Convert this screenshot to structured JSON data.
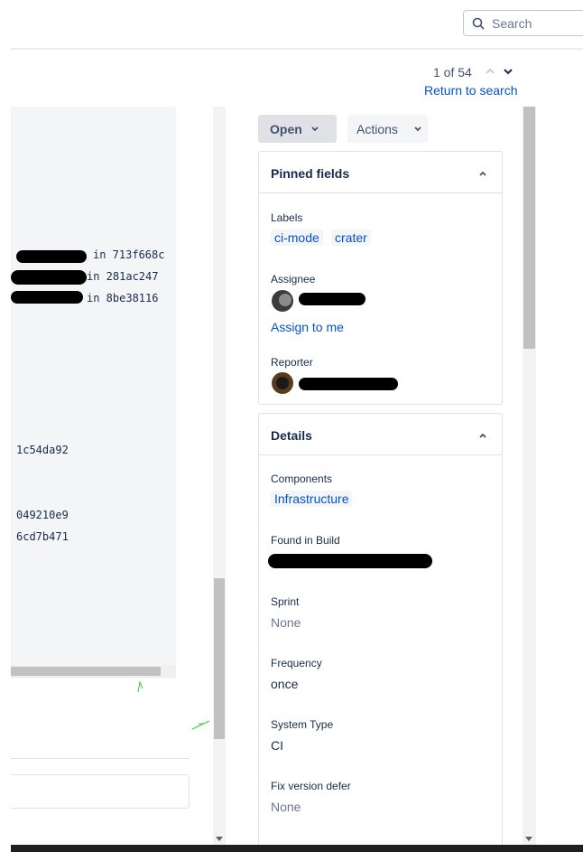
{
  "search": {
    "placeholder": "Search"
  },
  "pager": {
    "text": "1 of 54",
    "return_label": "Return to search"
  },
  "code": {
    "lines": [
      {
        "text": "in 713f668c"
      },
      {
        "text": "in 281ac247"
      },
      {
        "text": "in 8be38116"
      },
      {
        "text": "1c54da92"
      },
      {
        "text": "049210e9"
      },
      {
        "text": "6cd7b471"
      }
    ]
  },
  "toolbar": {
    "status_label": "Open",
    "actions_label": "Actions"
  },
  "pinned": {
    "title": "Pinned fields",
    "labels_label": "Labels",
    "labels": [
      "ci-mode",
      "crater"
    ],
    "assignee_label": "Assignee",
    "assign_to_me": "Assign to me",
    "reporter_label": "Reporter"
  },
  "details": {
    "title": "Details",
    "components_label": "Components",
    "components_value": "Infrastructure",
    "found_in_build_label": "Found in Build",
    "sprint_label": "Sprint",
    "sprint_value": "None",
    "frequency_label": "Frequency",
    "frequency_value": "once",
    "system_type_label": "System Type",
    "system_type_value": "CI",
    "fix_version_label": "Fix version defer",
    "fix_version_value": "None"
  },
  "colors": {
    "link": "#0052cc",
    "text": "#172b4d",
    "muted": "#6b778c"
  },
  "icons": [
    "search-icon",
    "chevron-up-icon",
    "chevron-down-icon"
  ]
}
